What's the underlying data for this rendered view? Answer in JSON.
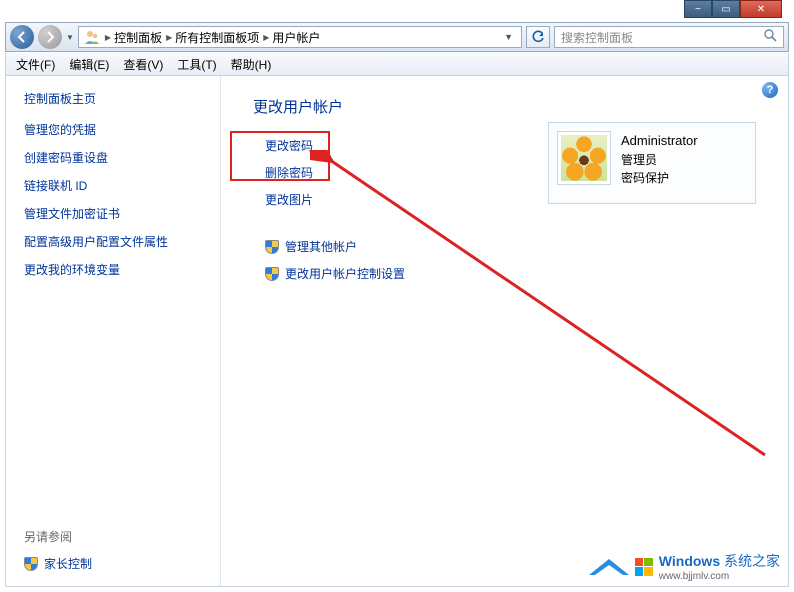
{
  "window": {
    "min": "−",
    "max": "▭",
    "close": "✕"
  },
  "nav": {
    "breadcrumb": [
      "控制面板",
      "所有控制面板项",
      "用户帐户"
    ],
    "search_placeholder": "搜索控制面板"
  },
  "menu": {
    "file": "文件(F)",
    "edit": "编辑(E)",
    "view": "查看(V)",
    "tools": "工具(T)",
    "help": "帮助(H)"
  },
  "sidebar": {
    "title": "控制面板主页",
    "items": [
      "管理您的凭据",
      "创建密码重设盘",
      "链接联机 ID",
      "管理文件加密证书",
      "配置高级用户配置文件属性",
      "更改我的环境变量"
    ],
    "see_also": "另请参阅",
    "parental": "家长控制"
  },
  "page": {
    "heading": "更改用户帐户",
    "actions_boxed": [
      "更改密码",
      "删除密码"
    ],
    "action_pic": "更改图片",
    "action_manage": "管理其他帐户",
    "action_uac": "更改用户帐户控制设置"
  },
  "account": {
    "name": "Administrator",
    "role": "管理员",
    "pw": "密码保护"
  },
  "help": "?",
  "watermark": {
    "brand": "Windows",
    "site": "系统之家",
    "url": "www.bjjmlv.com"
  }
}
